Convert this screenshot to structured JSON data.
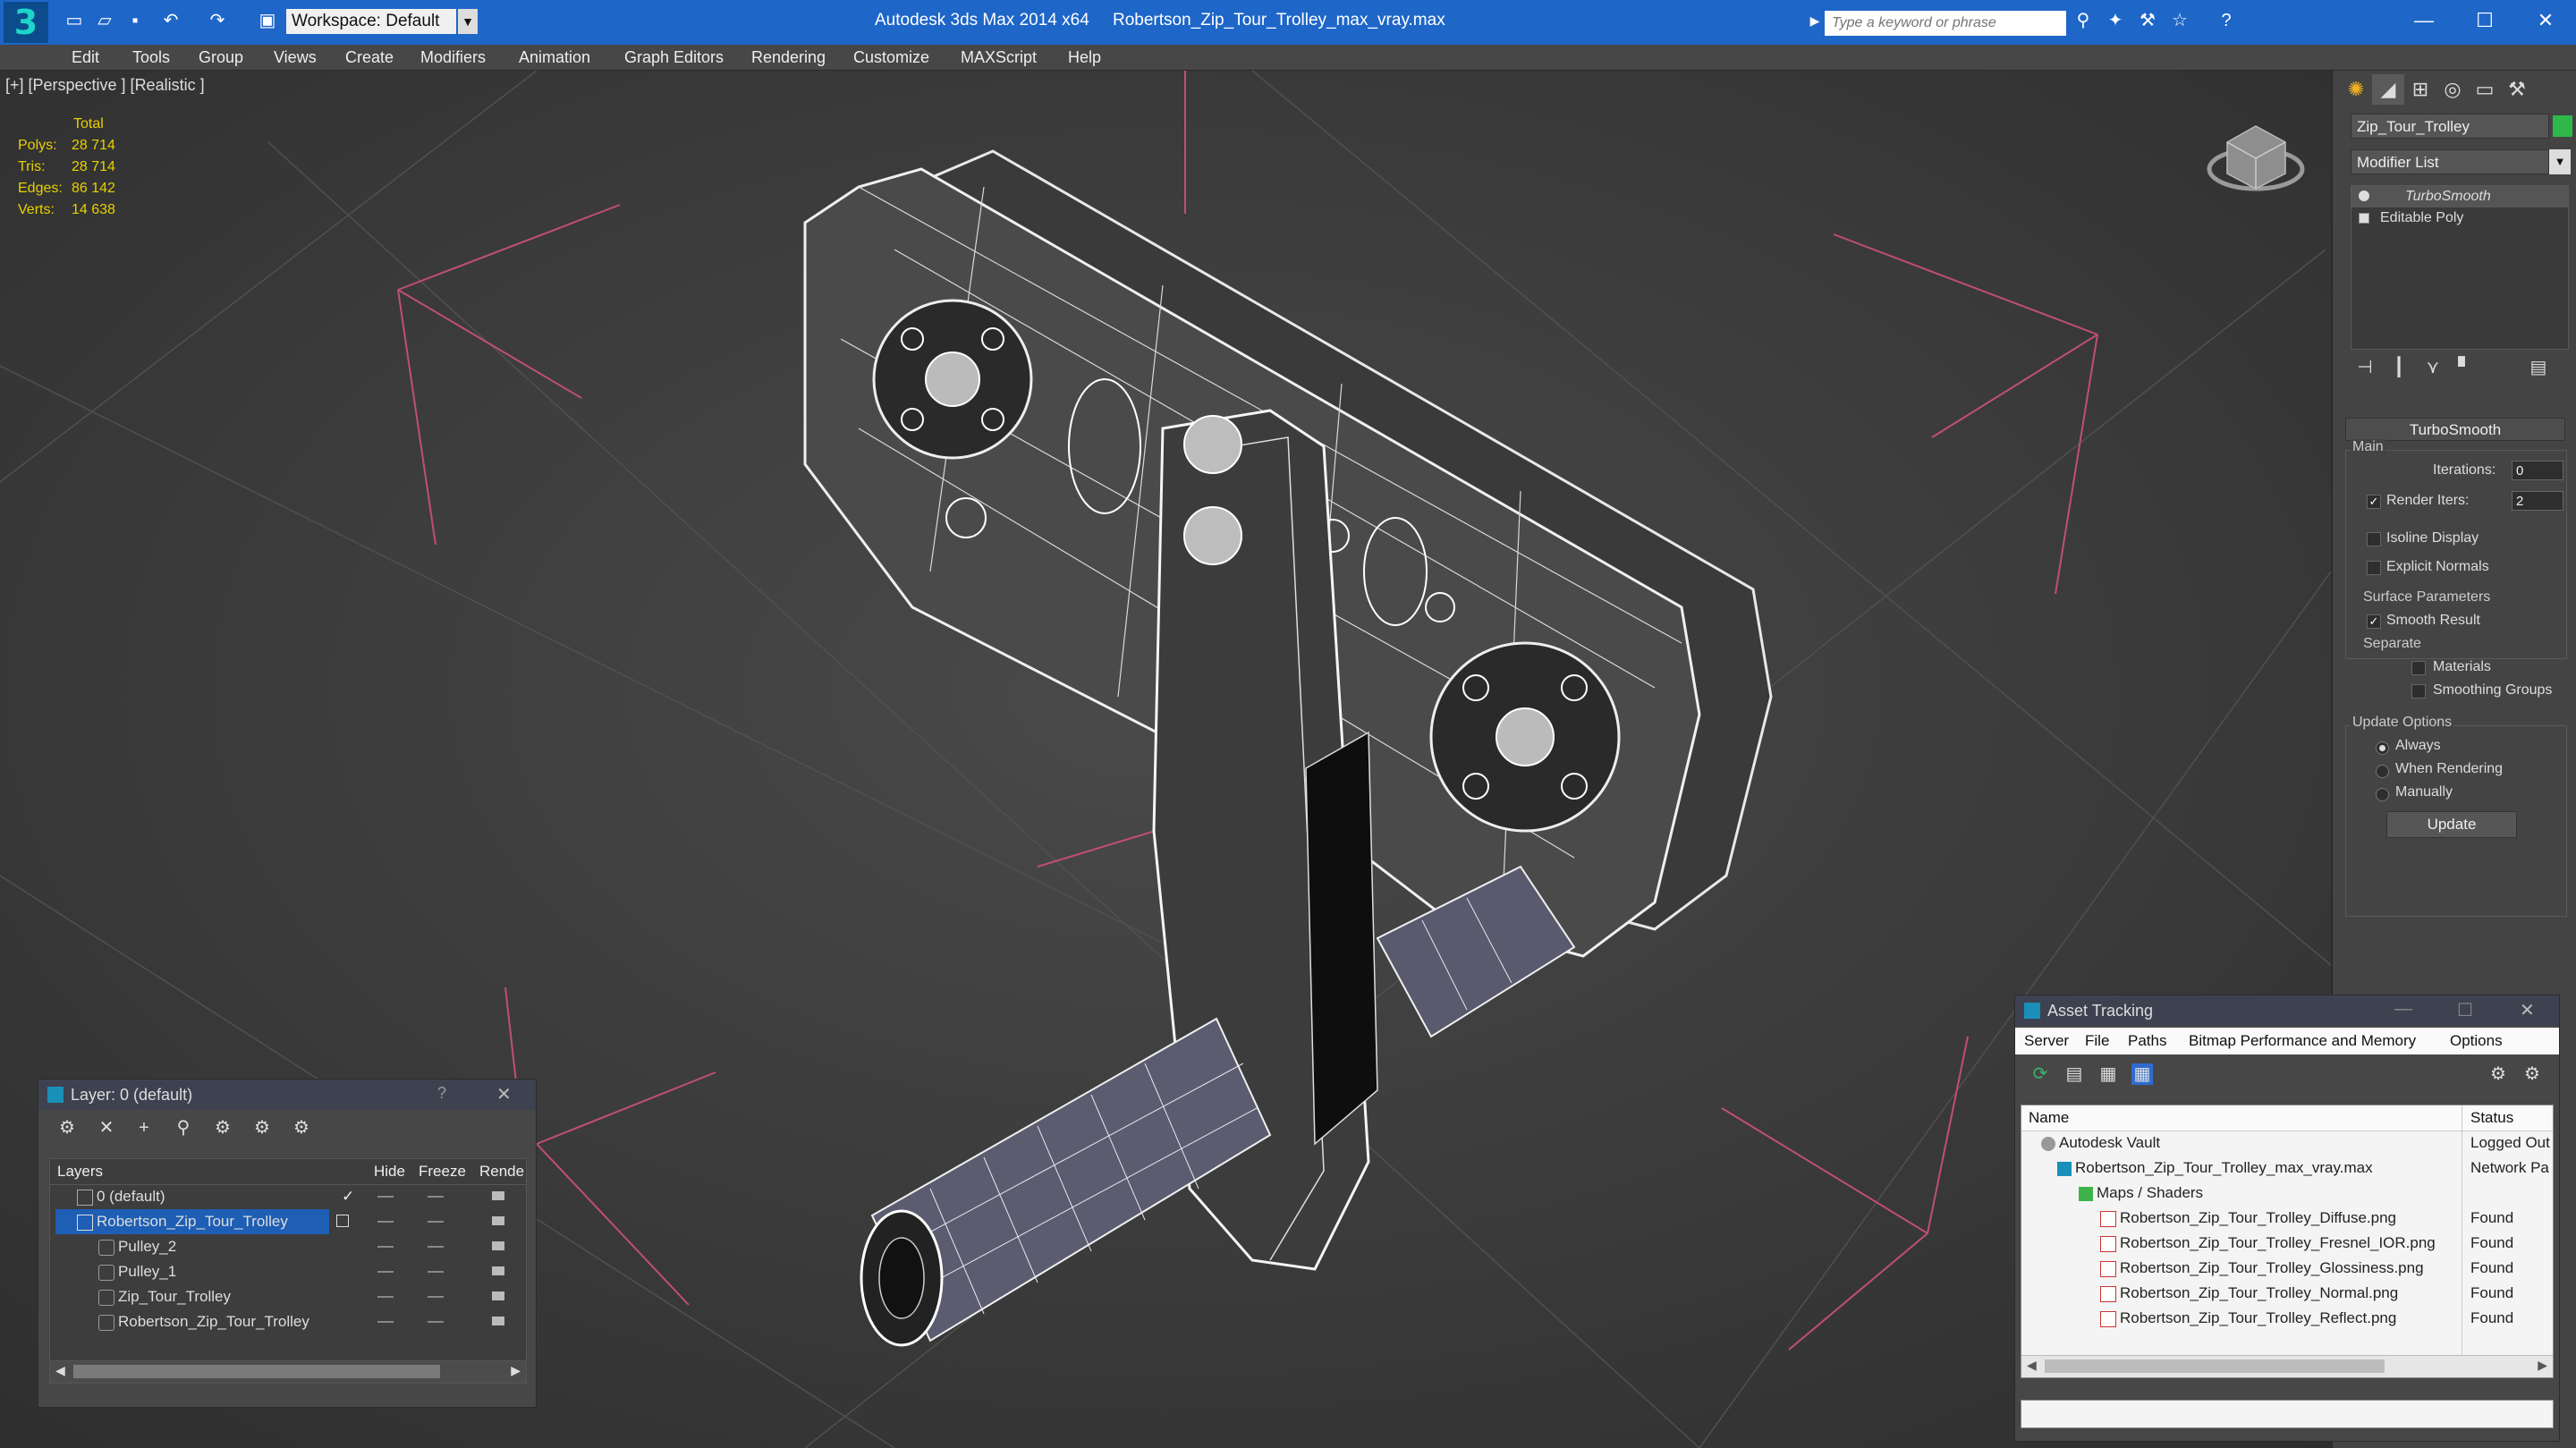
{
  "app": {
    "title": "Autodesk 3ds Max  2014 x64",
    "file": "Robertson_Zip_Tour_Trolley_max_vray.max",
    "workspace": "Workspace: Default",
    "search_placeholder": "Type a keyword or phrase"
  },
  "menu": [
    "Edit",
    "Tools",
    "Group",
    "Views",
    "Create",
    "Modifiers",
    "Animation",
    "Graph Editors",
    "Rendering",
    "Customize",
    "MAXScript",
    "Help"
  ],
  "viewport": {
    "label": "[+] [Perspective ] [Realistic ]",
    "stats_header": "Total",
    "stats": [
      {
        "k": "Polys:",
        "v": "28 714"
      },
      {
        "k": "Tris:",
        "v": "28 714"
      },
      {
        "k": "Edges:",
        "v": "86 142"
      },
      {
        "k": "Verts:",
        "v": "14 638"
      }
    ]
  },
  "command_panel": {
    "object_name": "Zip_Tour_Trolley",
    "modifier_list": "Modifier List",
    "stack": [
      "TurboSmooth",
      "Editable Poly"
    ],
    "rollout_title": "TurboSmooth",
    "main_group": "Main",
    "iterations_label": "Iterations:",
    "iterations_value": "0",
    "render_iters_label": "Render Iters:",
    "render_iters_value": "2",
    "isoline_display": "Isoline Display",
    "explicit_normals": "Explicit Normals",
    "surface_parameters": "Surface Parameters",
    "smooth_result": "Smooth Result",
    "separate": "Separate",
    "materials": "Materials",
    "smoothing_groups": "Smoothing Groups",
    "update_options": "Update Options",
    "always": "Always",
    "when_rendering": "When Rendering",
    "manually": "Manually",
    "update_button": "Update",
    "accent_color": "#2fb84a"
  },
  "layer_window": {
    "title": "Layer: 0 (default)",
    "columns": [
      "Layers",
      "Hide",
      "Freeze",
      "Rende"
    ],
    "rows": [
      {
        "name": "0 (default)",
        "selected": false,
        "indent": 1
      },
      {
        "name": "Robertson_Zip_Tour_Trolley",
        "selected": true,
        "indent": 1
      },
      {
        "name": "Pulley_2",
        "selected": false,
        "indent": 2
      },
      {
        "name": "Pulley_1",
        "selected": false,
        "indent": 2
      },
      {
        "name": "Zip_Tour_Trolley",
        "selected": false,
        "indent": 2
      },
      {
        "name": "Robertson_Zip_Tour_Trolley",
        "selected": false,
        "indent": 2
      }
    ]
  },
  "asset_window": {
    "title": "Asset Tracking",
    "menu": [
      "Server",
      "File",
      "Paths",
      "Bitmap Performance and Memory",
      "Options"
    ],
    "columns": [
      "Name",
      "Status"
    ],
    "rows": [
      {
        "name": "Autodesk Vault",
        "status": "Logged Out",
        "indent": 1
      },
      {
        "name": "Robertson_Zip_Tour_Trolley_max_vray.max",
        "status": "Network Pa",
        "indent": 2
      },
      {
        "name": "Maps / Shaders",
        "status": "",
        "indent": 3
      },
      {
        "name": "Robertson_Zip_Tour_Trolley_Diffuse.png",
        "status": "Found",
        "indent": 4
      },
      {
        "name": "Robertson_Zip_Tour_Trolley_Fresnel_IOR.png",
        "status": "Found",
        "indent": 4
      },
      {
        "name": "Robertson_Zip_Tour_Trolley_Glossiness.png",
        "status": "Found",
        "indent": 4
      },
      {
        "name": "Robertson_Zip_Tour_Trolley_Normal.png",
        "status": "Found",
        "indent": 4
      },
      {
        "name": "Robertson_Zip_Tour_Trolley_Reflect.png",
        "status": "Found",
        "indent": 4
      }
    ]
  }
}
